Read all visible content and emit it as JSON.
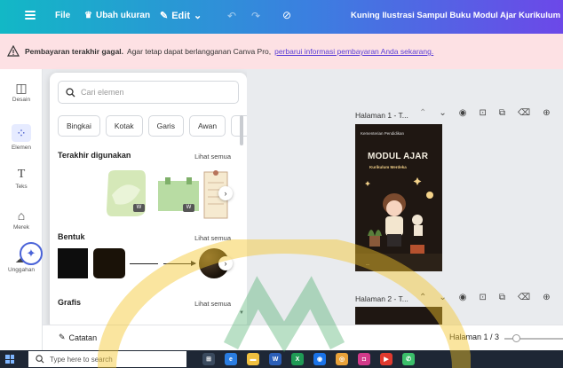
{
  "topbar": {
    "file_label": "File",
    "resize_label": "Ubah ukuran",
    "edit_label": "Edit",
    "document_title": "Kuning Ilustrasi Sampul Buku Modul Ajar Kurikulum Merde"
  },
  "alert": {
    "strong": "Pembayaran terakhir gagal.",
    "text": "Agar tetap dapat berlangganan Canva Pro,",
    "link": "perbarui informasi pembayaran Anda sekarang."
  },
  "rail": {
    "items": [
      {
        "label": "Desain",
        "icon": "layout-icon"
      },
      {
        "label": "Elemen",
        "icon": "shapes-icon"
      },
      {
        "label": "Teks",
        "icon": "text-icon"
      },
      {
        "label": "Merek",
        "icon": "brand-icon"
      },
      {
        "label": "Unggahan",
        "icon": "upload-icon"
      }
    ]
  },
  "panel": {
    "search_placeholder": "Cari elemen",
    "chips": [
      "Bingkai",
      "Kotak",
      "Garis",
      "Awan"
    ],
    "recent_title": "Terakhir digunakan",
    "shapes_title": "Bentuk",
    "graphics_title": "Grafis",
    "see_all": "Lihat semua"
  },
  "canvas": {
    "page1_label": "Halaman 1 - T...",
    "page2_label": "Halaman 2 - T...",
    "cover_title": "MODUL AJAR",
    "cover_subtitle": "Kurikulum Merdeka",
    "cover_logo_text": "Kementerian Pendidikan"
  },
  "footer": {
    "notes_label": "Catatan",
    "page_counter": "Halaman 1 / 3"
  },
  "taskbar": {
    "search_placeholder": "Type here to search"
  },
  "colors": {
    "topbar_start": "#12b8c6",
    "topbar_end": "#6c48e8",
    "alert_bg": "#fde1e4",
    "link": "#5b3fd6"
  }
}
